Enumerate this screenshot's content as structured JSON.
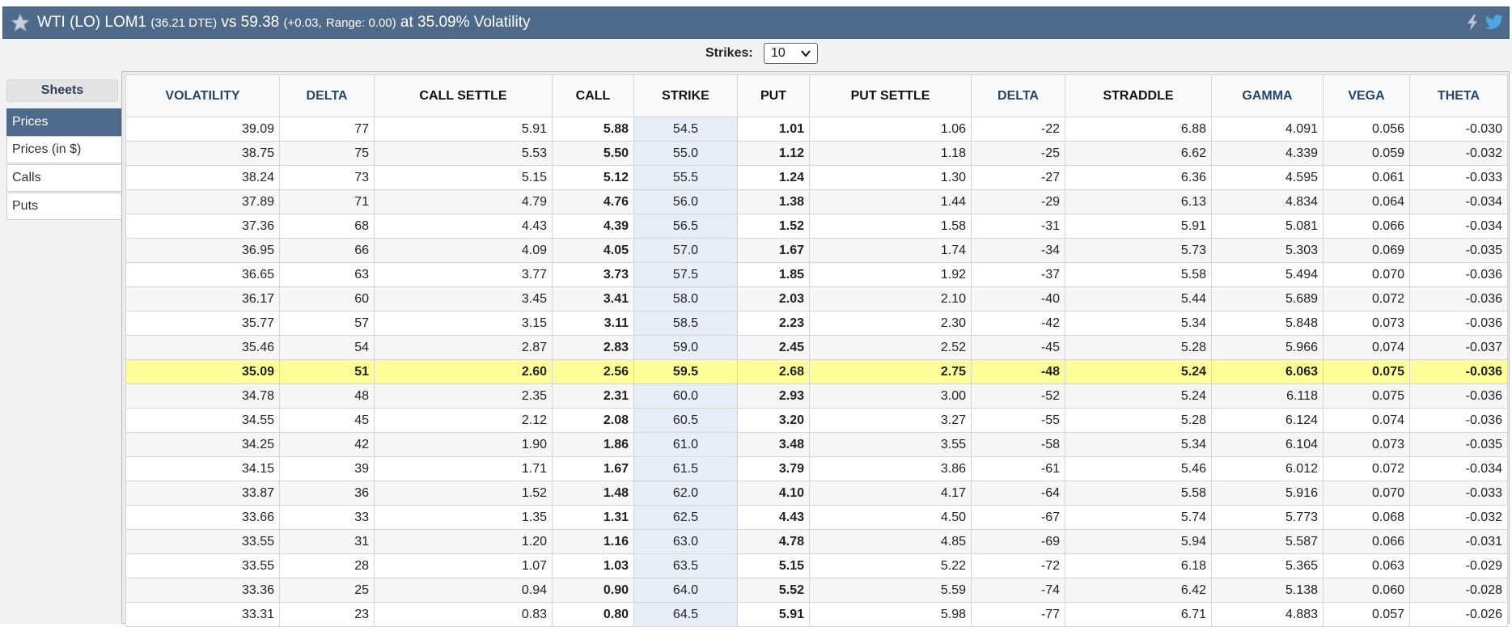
{
  "header": {
    "product": "WTI (LO) LOM1",
    "dte": "(36.21 DTE)",
    "vs_price": "vs 59.38",
    "change": "(+0.03,",
    "range": "Range: 0.00)",
    "volatility_text": "at 35.09% Volatility",
    "bg_color": "#4e6a8a"
  },
  "controls": {
    "strikes_label": "Strikes:",
    "strikes_value": "10"
  },
  "sidebar": {
    "title": "Sheets",
    "items": [
      {
        "label": "Prices",
        "active": true
      },
      {
        "label": "Prices (in $)",
        "active": false
      },
      {
        "label": "Calls",
        "active": false
      },
      {
        "label": "Puts",
        "active": false
      }
    ]
  },
  "table": {
    "columns": [
      "VOLATILITY",
      "DELTA",
      "CALL SETTLE",
      "CALL",
      "STRIKE",
      "PUT",
      "PUT SETTLE",
      "DELTA",
      "STRADDLE",
      "GAMMA",
      "VEGA",
      "THETA"
    ],
    "highlight_color": "#ffff99",
    "atm_row_index": 10,
    "rows": [
      [
        "39.09",
        "77",
        "5.91",
        "5.88",
        "54.5",
        "1.01",
        "1.06",
        "-22",
        "6.88",
        "4.091",
        "0.056",
        "-0.030"
      ],
      [
        "38.75",
        "75",
        "5.53",
        "5.50",
        "55.0",
        "1.12",
        "1.18",
        "-25",
        "6.62",
        "4.339",
        "0.059",
        "-0.032"
      ],
      [
        "38.24",
        "73",
        "5.15",
        "5.12",
        "55.5",
        "1.24",
        "1.30",
        "-27",
        "6.36",
        "4.595",
        "0.061",
        "-0.033"
      ],
      [
        "37.89",
        "71",
        "4.79",
        "4.76",
        "56.0",
        "1.38",
        "1.44",
        "-29",
        "6.13",
        "4.834",
        "0.064",
        "-0.034"
      ],
      [
        "37.36",
        "68",
        "4.43",
        "4.39",
        "56.5",
        "1.52",
        "1.58",
        "-31",
        "5.91",
        "5.081",
        "0.066",
        "-0.034"
      ],
      [
        "36.95",
        "66",
        "4.09",
        "4.05",
        "57.0",
        "1.67",
        "1.74",
        "-34",
        "5.73",
        "5.303",
        "0.069",
        "-0.035"
      ],
      [
        "36.65",
        "63",
        "3.77",
        "3.73",
        "57.5",
        "1.85",
        "1.92",
        "-37",
        "5.58",
        "5.494",
        "0.070",
        "-0.036"
      ],
      [
        "36.17",
        "60",
        "3.45",
        "3.41",
        "58.0",
        "2.03",
        "2.10",
        "-40",
        "5.44",
        "5.689",
        "0.072",
        "-0.036"
      ],
      [
        "35.77",
        "57",
        "3.15",
        "3.11",
        "58.5",
        "2.23",
        "2.30",
        "-42",
        "5.34",
        "5.848",
        "0.073",
        "-0.036"
      ],
      [
        "35.46",
        "54",
        "2.87",
        "2.83",
        "59.0",
        "2.45",
        "2.52",
        "-45",
        "5.28",
        "5.966",
        "0.074",
        "-0.037"
      ],
      [
        "35.09",
        "51",
        "2.60",
        "2.56",
        "59.5",
        "2.68",
        "2.75",
        "-48",
        "5.24",
        "6.063",
        "0.075",
        "-0.036"
      ],
      [
        "34.78",
        "48",
        "2.35",
        "2.31",
        "60.0",
        "2.93",
        "3.00",
        "-52",
        "5.24",
        "6.118",
        "0.075",
        "-0.036"
      ],
      [
        "34.55",
        "45",
        "2.12",
        "2.08",
        "60.5",
        "3.20",
        "3.27",
        "-55",
        "5.28",
        "6.124",
        "0.074",
        "-0.036"
      ],
      [
        "34.25",
        "42",
        "1.90",
        "1.86",
        "61.0",
        "3.48",
        "3.55",
        "-58",
        "5.34",
        "6.104",
        "0.073",
        "-0.035"
      ],
      [
        "34.15",
        "39",
        "1.71",
        "1.67",
        "61.5",
        "3.79",
        "3.86",
        "-61",
        "5.46",
        "6.012",
        "0.072",
        "-0.034"
      ],
      [
        "33.87",
        "36",
        "1.52",
        "1.48",
        "62.0",
        "4.10",
        "4.17",
        "-64",
        "5.58",
        "5.916",
        "0.070",
        "-0.033"
      ],
      [
        "33.66",
        "33",
        "1.35",
        "1.31",
        "62.5",
        "4.43",
        "4.50",
        "-67",
        "5.74",
        "5.773",
        "0.068",
        "-0.032"
      ],
      [
        "33.55",
        "31",
        "1.20",
        "1.16",
        "63.0",
        "4.78",
        "4.85",
        "-69",
        "5.94",
        "5.587",
        "0.066",
        "-0.031"
      ],
      [
        "33.55",
        "28",
        "1.07",
        "1.03",
        "63.5",
        "5.15",
        "5.22",
        "-72",
        "6.18",
        "5.365",
        "0.063",
        "-0.029"
      ],
      [
        "33.36",
        "25",
        "0.94",
        "0.90",
        "64.0",
        "5.52",
        "5.59",
        "-74",
        "6.42",
        "5.138",
        "0.060",
        "-0.028"
      ],
      [
        "33.31",
        "23",
        "0.83",
        "0.80",
        "64.5",
        "5.91",
        "5.98",
        "-77",
        "6.71",
        "4.883",
        "0.057",
        "-0.026"
      ]
    ]
  }
}
